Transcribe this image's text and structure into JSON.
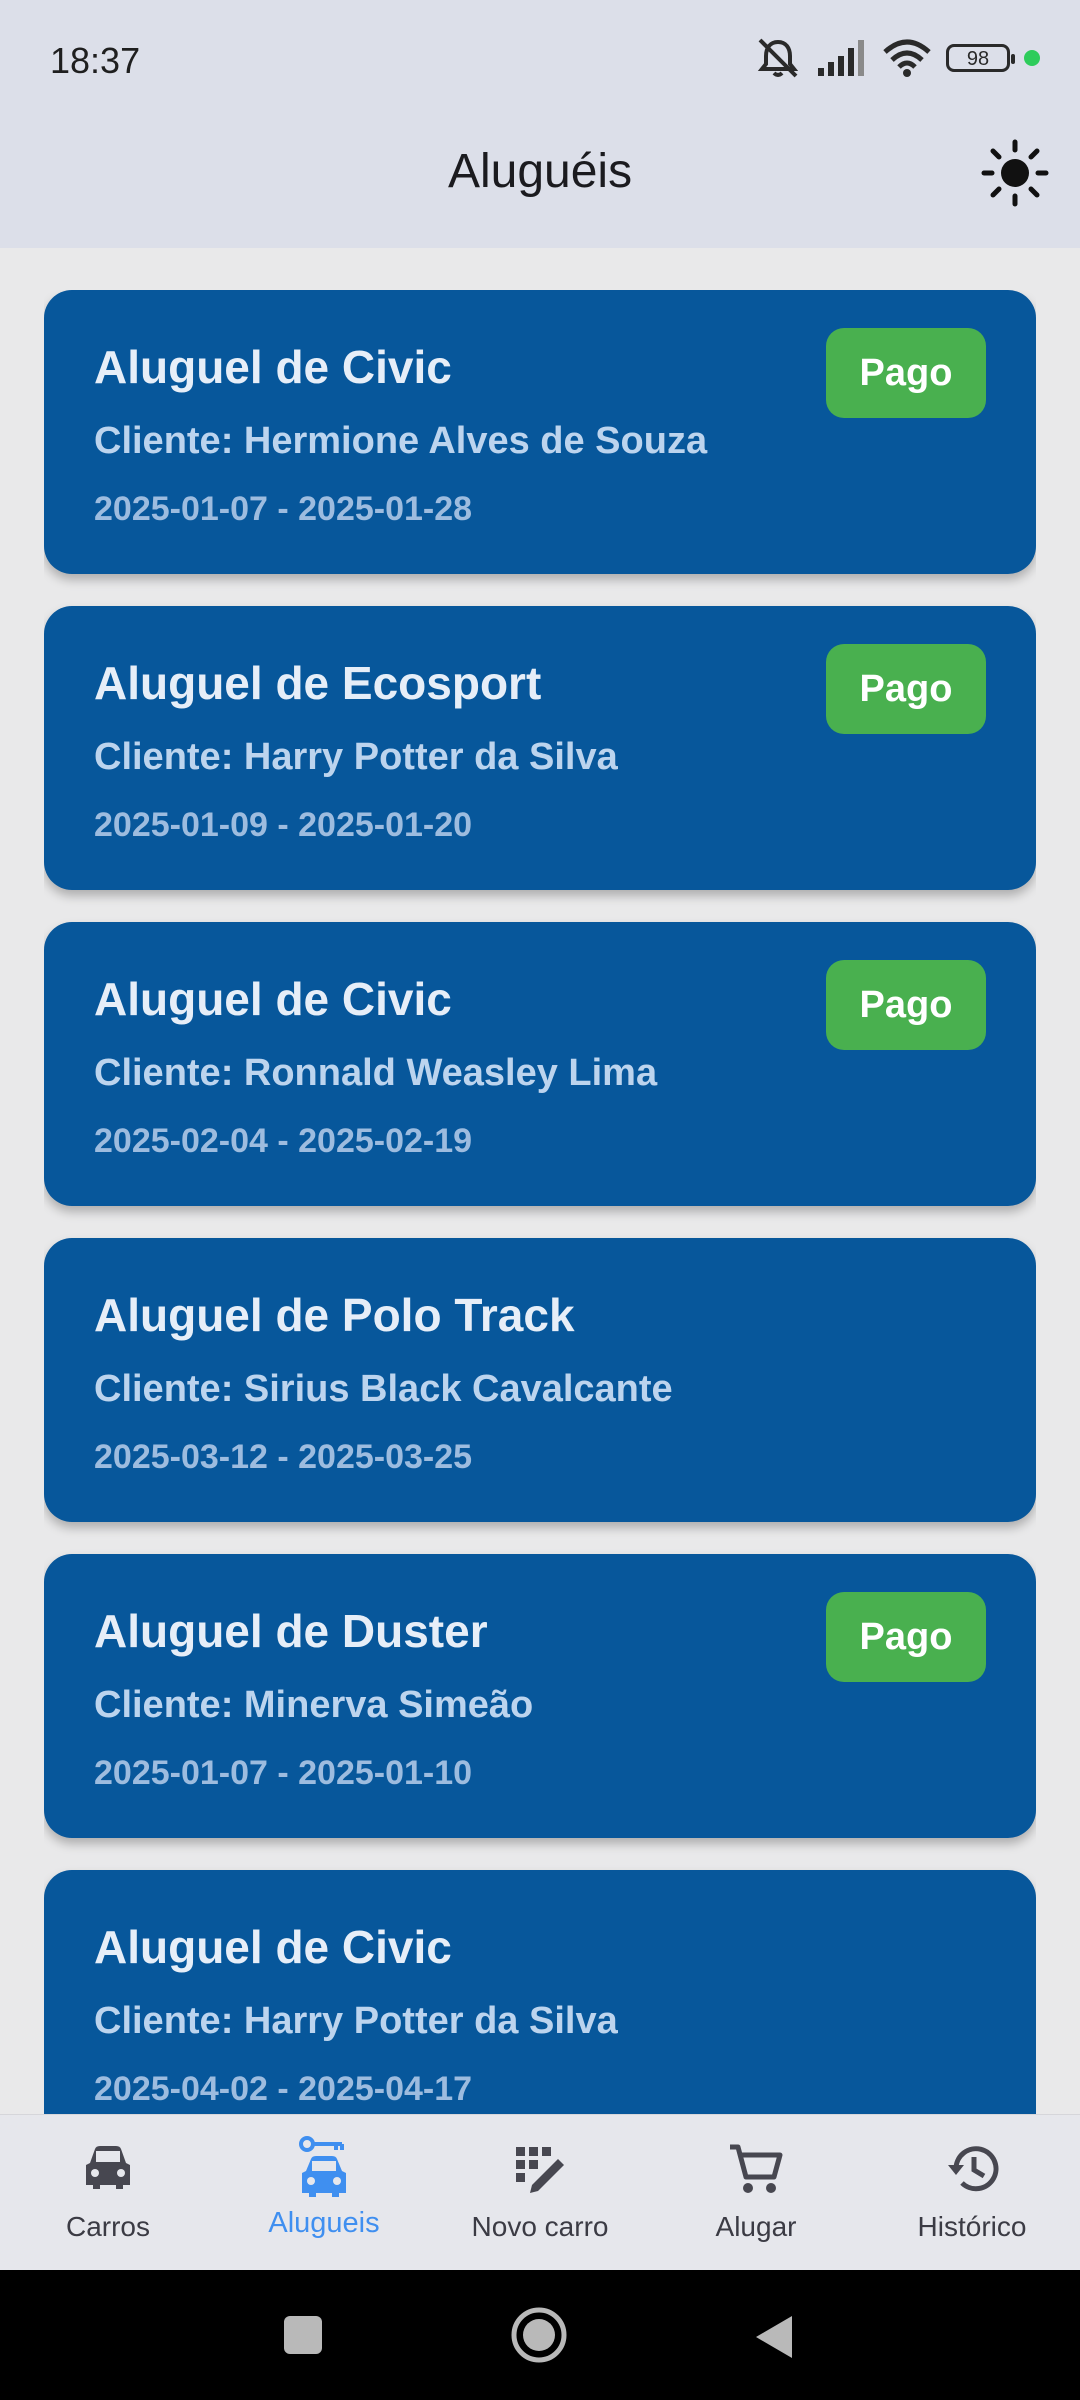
{
  "status_bar": {
    "time": "18:37",
    "battery": "98"
  },
  "app_bar": {
    "title": "Aluguéis",
    "theme_icon": "sun-icon"
  },
  "rentals": [
    {
      "title": "Aluguel de Civic",
      "client": "Cliente: Hermione Alves de Souza",
      "dates": "2025-01-07 - 2025-01-28",
      "status": "Pago"
    },
    {
      "title": "Aluguel de Ecosport",
      "client": "Cliente: Harry Potter da Silva",
      "dates": "2025-01-09 - 2025-01-20",
      "status": "Pago"
    },
    {
      "title": "Aluguel de Civic",
      "client": "Cliente: Ronnald Weasley Lima",
      "dates": "2025-02-04 - 2025-02-19",
      "status": "Pago"
    },
    {
      "title": "Aluguel de Polo Track",
      "client": "Cliente: Sirius Black Cavalcante",
      "dates": "2025-03-12 - 2025-03-25",
      "status": ""
    },
    {
      "title": "Aluguel de Duster",
      "client": "Cliente: Minerva Simeão",
      "dates": "2025-01-07 - 2025-01-10",
      "status": "Pago"
    },
    {
      "title": "Aluguel de Civic",
      "client": "Cliente: Harry Potter da Silva",
      "dates": "2025-04-02 - 2025-04-17",
      "status": ""
    }
  ],
  "bottom_nav": [
    {
      "label": "Carros",
      "icon": "car-icon",
      "active": false
    },
    {
      "label": "Alugueis",
      "icon": "car-key-icon",
      "active": true
    },
    {
      "label": "Novo carro",
      "icon": "add-car-icon",
      "active": false
    },
    {
      "label": "Alugar",
      "icon": "cart-icon",
      "active": false
    },
    {
      "label": "Histórico",
      "icon": "history-icon",
      "active": false
    }
  ],
  "colors": {
    "card": "#07579b",
    "badge": "#49b04f",
    "active": "#3f8ff0",
    "bar": "#dcdfe9"
  }
}
